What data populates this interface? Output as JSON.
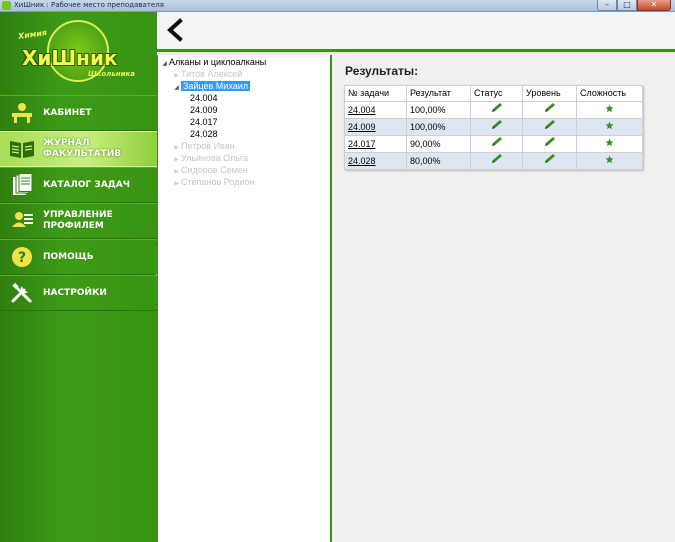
{
  "window": {
    "title": "ХиШник : Рабочее место преподавателя",
    "buttons": [
      "–",
      "□",
      "✕"
    ]
  },
  "logo": {
    "top_text": "Химия",
    "main_text": "ХиШник",
    "bottom_text": "Школьника"
  },
  "nav": [
    {
      "label1": "Кабинет",
      "label2": "",
      "icon": "desk-icon"
    },
    {
      "label1": "Журнал",
      "label2": "факультатив",
      "icon": "journal-icon"
    },
    {
      "label1": "Каталог задач",
      "label2": "",
      "icon": "catalog-icon"
    },
    {
      "label1": "Управление",
      "label2": "профилем",
      "icon": "profile-icon"
    },
    {
      "label1": "Помощь",
      "label2": "",
      "icon": "help-icon"
    },
    {
      "label1": "Настройки",
      "label2": "",
      "icon": "settings-icon"
    }
  ],
  "toolbar": {
    "back_icon": "back-arrow-icon"
  },
  "tree": {
    "root": "Алканы и циклоалканы",
    "students": [
      {
        "name": "Титов  Алексей",
        "expanded": false,
        "selected": false
      },
      {
        "name": "Зайцев Михаил",
        "expanded": true,
        "selected": true,
        "tasks": [
          "24.004",
          "24.009",
          "24.017",
          "24.028"
        ]
      },
      {
        "name": "Петров  Иван",
        "expanded": false,
        "selected": false
      },
      {
        "name": "Ульянова Ольга",
        "expanded": false,
        "selected": false
      },
      {
        "name": "Сидоров Семен",
        "expanded": false,
        "selected": false
      },
      {
        "name": "Степанов Родион",
        "expanded": false,
        "selected": false
      }
    ]
  },
  "results": {
    "title": "Результаты:",
    "columns": [
      "№ задачи",
      "Результат",
      "Статус",
      "Уровень",
      "Сложность"
    ],
    "rows": [
      {
        "id": "24.004",
        "result": "100,00%"
      },
      {
        "id": "24.009",
        "result": "100,00%"
      },
      {
        "id": "24.017",
        "result": "90,00%"
      },
      {
        "id": "24.028",
        "result": "80,00%"
      }
    ]
  },
  "colors": {
    "sidebar_green": "#3a9313",
    "active_item": "#b8e86a",
    "selection_blue": "#3399ff",
    "row_alt": "#dde6f1",
    "pencil_green": "#3b8d22"
  }
}
